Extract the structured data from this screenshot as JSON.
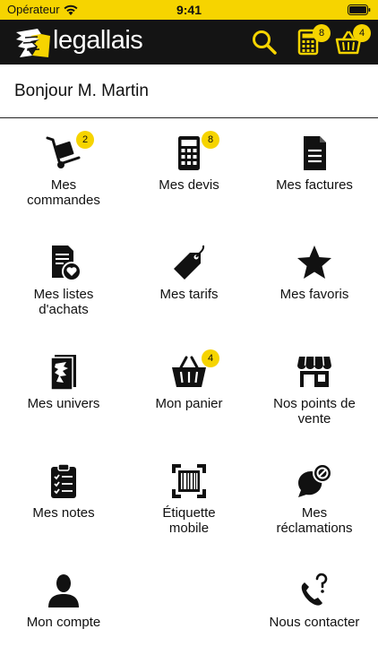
{
  "status_bar": {
    "carrier": "Opérateur",
    "time": "9:41"
  },
  "nav": {
    "brand": "legallais",
    "search_icon": "search-icon",
    "quotes_badge": "8",
    "cart_badge": "4"
  },
  "greeting": "Bonjour M. Martin",
  "colors": {
    "accent": "#f6d400",
    "nav_bg": "#141414"
  },
  "tiles": [
    {
      "label": "Mes\ncommandes",
      "icon": "hand-truck-icon",
      "badge": "2"
    },
    {
      "label": "Mes devis",
      "icon": "calculator-icon",
      "badge": "8"
    },
    {
      "label": "Mes factures",
      "icon": "invoice-icon"
    },
    {
      "label": "Mes listes\nd'achats",
      "icon": "list-heart-icon"
    },
    {
      "label": "Mes tarifs",
      "icon": "price-tag-icon"
    },
    {
      "label": "Mes favoris",
      "icon": "star-icon"
    },
    {
      "label": "Mes univers",
      "icon": "catalog-icon"
    },
    {
      "label": "Mon panier",
      "icon": "basket-icon",
      "badge": "4"
    },
    {
      "label": "Nos points de\nvente",
      "icon": "store-icon"
    },
    {
      "label": "Mes notes",
      "icon": "clipboard-icon"
    },
    {
      "label": "Étiquette\nmobile",
      "icon": "barcode-icon"
    },
    {
      "label": "Mes\nréclamations",
      "icon": "complaint-icon"
    },
    {
      "label": "Mon compte",
      "icon": "user-icon"
    },
    {
      "label": "Nous contacter",
      "icon": "phone-question-icon"
    }
  ]
}
